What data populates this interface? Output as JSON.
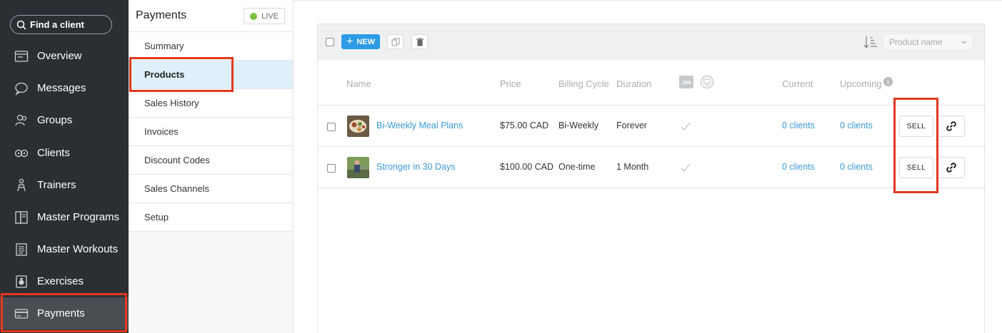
{
  "sidebar": {
    "search_label": "Find a client",
    "items": [
      {
        "label": "Overview",
        "icon": "overview-icon"
      },
      {
        "label": "Messages",
        "icon": "messages-icon"
      },
      {
        "label": "Groups",
        "icon": "groups-icon"
      },
      {
        "label": "Clients",
        "icon": "clients-icon"
      },
      {
        "label": "Trainers",
        "icon": "trainers-icon"
      },
      {
        "label": "Master Programs",
        "icon": "programs-icon"
      },
      {
        "label": "Master Workouts",
        "icon": "workouts-icon"
      },
      {
        "label": "Exercises",
        "icon": "exercises-icon"
      },
      {
        "label": "Payments",
        "icon": "payments-icon",
        "active": true
      }
    ]
  },
  "panel": {
    "title": "Payments",
    "status_label": "LIVE",
    "status_color": "#7ac143",
    "menu": [
      "Summary",
      "Products",
      "Sales History",
      "Invoices",
      "Discount Codes",
      "Sales Channels",
      "Setup"
    ],
    "active_item": "Products"
  },
  "toolbar": {
    "new_label": "NEW",
    "sort_placeholder": "Product name"
  },
  "table": {
    "headers": {
      "name": "Name",
      "price": "Price",
      "billing": "Billing Cycle",
      "duration": "Duration",
      "me_badge": ".me",
      "current": "Current",
      "upcoming": "Upcoming",
      "info_glyph": "i"
    },
    "rows": [
      {
        "name": "Bi-Weekly Meal Plans",
        "price": "$75.00 CAD",
        "billing": "Bi-Weekly",
        "duration": "Forever",
        "current": "0 clients",
        "upcoming": "0 clients",
        "sell_label": "SELL"
      },
      {
        "name": "Stronger in 30 Days",
        "price": "$100.00 CAD",
        "billing": "One-time",
        "duration": "1 Month",
        "current": "0 clients",
        "upcoming": "0 clients",
        "sell_label": "SELL"
      }
    ]
  },
  "colors": {
    "accent": "#2d9be6",
    "link": "#3a9ad9",
    "highlight": "#e2391f",
    "sidebar_bg": "#2b2f33"
  }
}
